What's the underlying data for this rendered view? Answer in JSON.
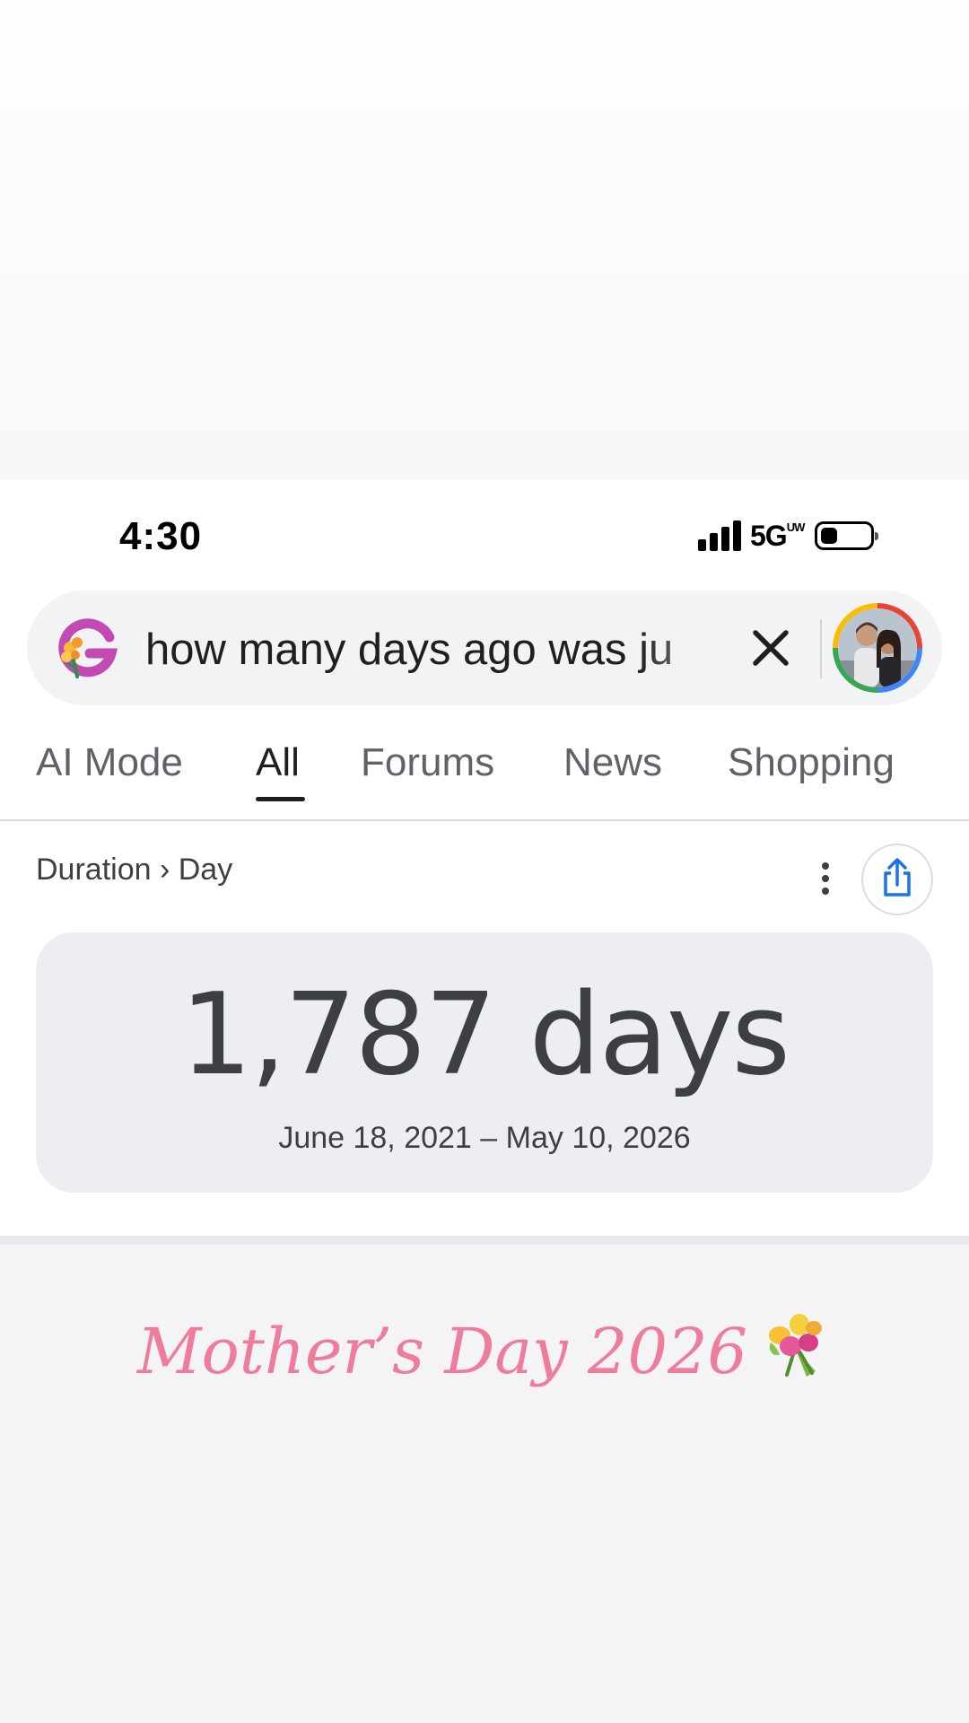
{
  "status_bar": {
    "time": "4:30",
    "network": "5G",
    "network_badge": "UW"
  },
  "search": {
    "query": "how many days ago was ju",
    "logo_icon": "google-g-flowers-icon",
    "clear_icon": "close-icon",
    "avatar_icon": "profile-avatar"
  },
  "tabs": [
    {
      "label": "AI Mode",
      "active": false
    },
    {
      "label": "All",
      "active": true
    },
    {
      "label": "Forums",
      "active": false
    },
    {
      "label": "News",
      "active": false
    },
    {
      "label": "Shopping",
      "active": false
    }
  ],
  "result": {
    "breadcrumb": "Duration › Day",
    "value": "1,787 days",
    "range": "June 18, 2021 – May 10, 2026",
    "more_icon": "more-vert-icon",
    "share_icon": "share-icon"
  },
  "caption": {
    "text": "Mother’s Day 2026",
    "emoji_icon": "bouquet-icon",
    "color": "#ee7d9c"
  }
}
